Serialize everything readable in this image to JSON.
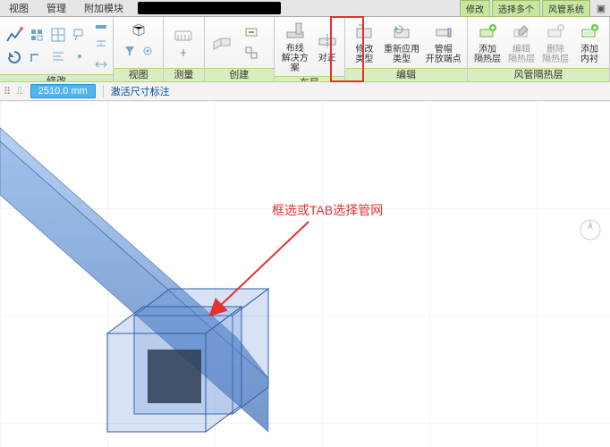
{
  "tabs": {
    "view": "视图",
    "manage": "管理",
    "addins": "附加模块",
    "modify": "修改",
    "select_multi": "选择多个",
    "duct_system": "风管系统"
  },
  "panels": {
    "modify": "修改",
    "view": "视图",
    "measure": "测量",
    "create": "创建",
    "layout_group": "布局",
    "edit": "编辑",
    "insulation": "风管隔热层"
  },
  "layout": {
    "route": "布线",
    "solution": "解决方案",
    "justify": "对正"
  },
  "edit": {
    "edit_type1": "修改",
    "edit_type2": "类型",
    "reapply1": "重新应用",
    "reapply2": "类型",
    "cap1": "管帽",
    "cap2": "开放端点"
  },
  "ins": {
    "add1": "添加",
    "add2": "隔热层",
    "edit1": "编辑",
    "edit2": "隔热层",
    "del1": "删除",
    "del2": "隔热层",
    "liner1": "添加",
    "liner2": "内衬"
  },
  "subbar": {
    "value": "2510.0 mm",
    "activate": "激活尺寸标注"
  },
  "annotation": "框选或TAB选择管网"
}
